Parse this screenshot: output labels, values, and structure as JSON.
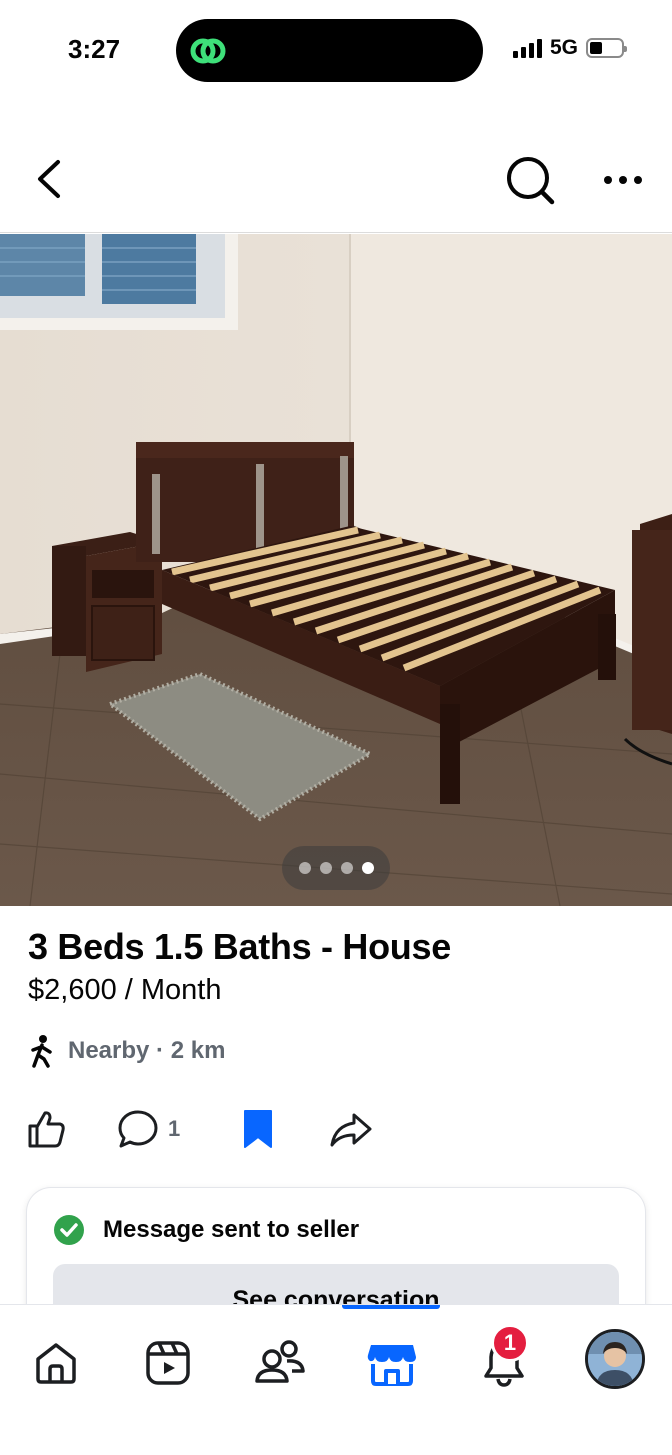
{
  "status_bar": {
    "time": "3:27",
    "network": "5G",
    "island_icon": "link-chain-icon",
    "battery_level": 0.3
  },
  "header": {
    "back_icon": "chevron-left-icon",
    "search_icon": "search-icon",
    "more_icon": "more-horizontal-icon"
  },
  "photo": {
    "page_count": 4,
    "active_page": 4
  },
  "listing": {
    "title": "3 Beds 1.5 Baths - House",
    "price": "$2,600 / Month",
    "location": "Nearby · 2 km"
  },
  "actions": {
    "like_icon": "thumbs-up-icon",
    "comment_icon": "comment-icon",
    "comment_count": "1",
    "save_icon": "bookmark-filled-icon",
    "share_icon": "share-arrow-icon"
  },
  "message_card": {
    "status": "Message sent to seller",
    "button_label": "See conversation"
  },
  "tabbar": {
    "items": [
      {
        "name": "home",
        "icon": "home-icon"
      },
      {
        "name": "video",
        "icon": "reels-icon"
      },
      {
        "name": "friends",
        "icon": "friends-icon"
      },
      {
        "name": "marketplace",
        "icon": "marketplace-icon",
        "active": true
      },
      {
        "name": "notifications",
        "icon": "bell-icon",
        "badge": "1"
      },
      {
        "name": "profile",
        "icon": "avatar"
      }
    ],
    "notification_badge": "1"
  },
  "colors": {
    "accent": "#0866ff",
    "success": "#31a24c",
    "badge": "#e41e3f",
    "island_icon": "#3ee07a",
    "secondary_text": "#606770"
  }
}
